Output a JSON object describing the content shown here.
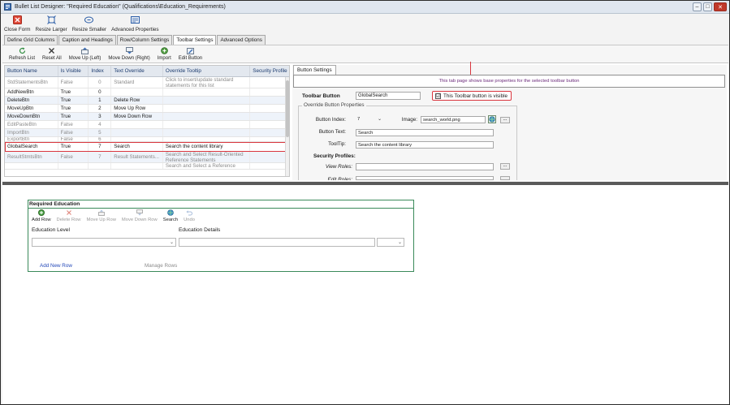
{
  "window": {
    "title": "Bullet List Designer: \"Required Education\" (Qualifications\\Education_Requirements)"
  },
  "ribbon": {
    "buttons": [
      "Close Form",
      "Resize Larger",
      "Resize Smaller",
      "Advanced Properties"
    ]
  },
  "tabs": [
    "Define Grid Columns",
    "Caption and Headings",
    "Row/Column Settings",
    "Toolbar Settings",
    "Advanced Options"
  ],
  "toolbar": {
    "buttons": [
      "Refresh List",
      "Reset All",
      "Move Up (Left)",
      "Move Down (Right)",
      "Import",
      "Edit Button"
    ]
  },
  "grid": {
    "headers": [
      "Button Name",
      "Is Visible",
      "Index",
      "Text Override",
      "Override Tooltip",
      "Security Profile"
    ],
    "rows": [
      {
        "name": "StdStatementsBtn",
        "visible": "False",
        "index": "0",
        "text": "Standard Statements...",
        "tooltip": "Click to insert/update standard statements for this list"
      },
      {
        "name": "AddNewBtn",
        "visible": "True",
        "index": "0",
        "text": "",
        "tooltip": ""
      },
      {
        "name": "DeleteBtn",
        "visible": "True",
        "index": "1",
        "text": "Delete Row",
        "tooltip": ""
      },
      {
        "name": "MoveUpBtn",
        "visible": "True",
        "index": "2",
        "text": "Move Up Row",
        "tooltip": ""
      },
      {
        "name": "MoveDownBtn",
        "visible": "True",
        "index": "3",
        "text": "Move Down Row",
        "tooltip": ""
      },
      {
        "name": "EditPasteBtn",
        "visible": "False",
        "index": "4",
        "text": "",
        "tooltip": ""
      },
      {
        "name": "ImportBtn",
        "visible": "False",
        "index": "5",
        "text": "",
        "tooltip": ""
      },
      {
        "name": "ExportBtn",
        "visible": "False",
        "index": "6",
        "text": "",
        "tooltip": ""
      },
      {
        "name": "GlobalSearch",
        "visible": "True",
        "index": "7",
        "text": "Search",
        "tooltip": "Search the content library"
      },
      {
        "name": "ResultStmtsBtn",
        "visible": "False",
        "index": "7",
        "text": "Result Statements...",
        "tooltip": "Search and Select Result-Oriented Reference Statements"
      },
      {
        "name": "",
        "visible": "",
        "index": "",
        "text": "",
        "tooltip": "Search and Select a Reference"
      }
    ]
  },
  "button_settings": {
    "tab_label": "Button Settings",
    "info": "This tab page shows base properties for the selected toolbar button",
    "toolbar_button_label": "Toolbar Button",
    "toolbar_button_value": "GlobalSearch",
    "visible_checkbox_label": "This Toolbar button is visible",
    "visible_checked": "☑",
    "override_title": "Override Button Properties",
    "button_index_label": "Button Index:",
    "button_index_value": "7",
    "image_label": "Image:",
    "image_value": "search_world.png",
    "button_text_label": "Button Text:",
    "button_text_value": "Search",
    "tooltip_label": "ToolTip:",
    "tooltip_value": "Search the content library",
    "security_profiles_label": "Security Profiles:",
    "view_roles_label": "View Roles:",
    "edit_roles_label": "Edit Roles:",
    "browse_label": "..."
  },
  "preview": {
    "title": "Required Education",
    "tools": [
      "Add Row",
      "Delete Row",
      "Move Up Row",
      "Move Down Row",
      "Search",
      "Undo"
    ],
    "col_education_level": "Education Level",
    "col_education_details": "Education Details",
    "add_new_row": "Add New Row",
    "manage_rows": "Manage Rows"
  },
  "colors": {
    "selection_highlight": "#d9363e",
    "preview_border": "#3a8a5a",
    "link": "#2247b8"
  }
}
